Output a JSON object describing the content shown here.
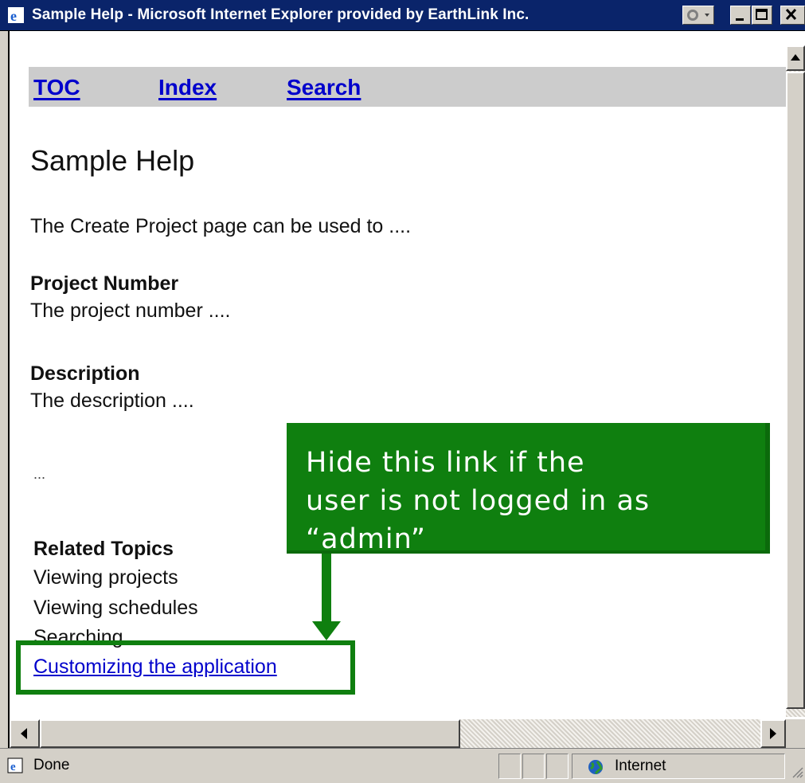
{
  "window": {
    "title": "Sample Help - Microsoft Internet Explorer provided by EarthLink Inc."
  },
  "nav": {
    "toc": "TOC",
    "index": "Index",
    "search": "Search"
  },
  "page": {
    "title": "Sample Help",
    "intro": "The Create Project page can be used to ....",
    "fields": [
      {
        "heading": "Project Number",
        "body": "The project number ...."
      },
      {
        "heading": "Description",
        "body": "The description ...."
      }
    ],
    "ellipsis": "...",
    "related": {
      "heading": "Related Topics",
      "items": [
        "Viewing projects",
        "Viewing schedules",
        "Searching"
      ],
      "link": "Customizing the application"
    }
  },
  "callout": {
    "lines": [
      "Hide this link if the",
      "user is not logged in as",
      "“admin”"
    ],
    "color": "#0f7f0f"
  },
  "status": {
    "text": "Done",
    "zone": "Internet"
  },
  "icons": [
    "ie-logo-icon",
    "throbber-icon",
    "minimize-icon",
    "maximize-icon",
    "close-icon",
    "scroll-up-icon",
    "scroll-left-icon",
    "scroll-right-icon",
    "globe-icon"
  ]
}
